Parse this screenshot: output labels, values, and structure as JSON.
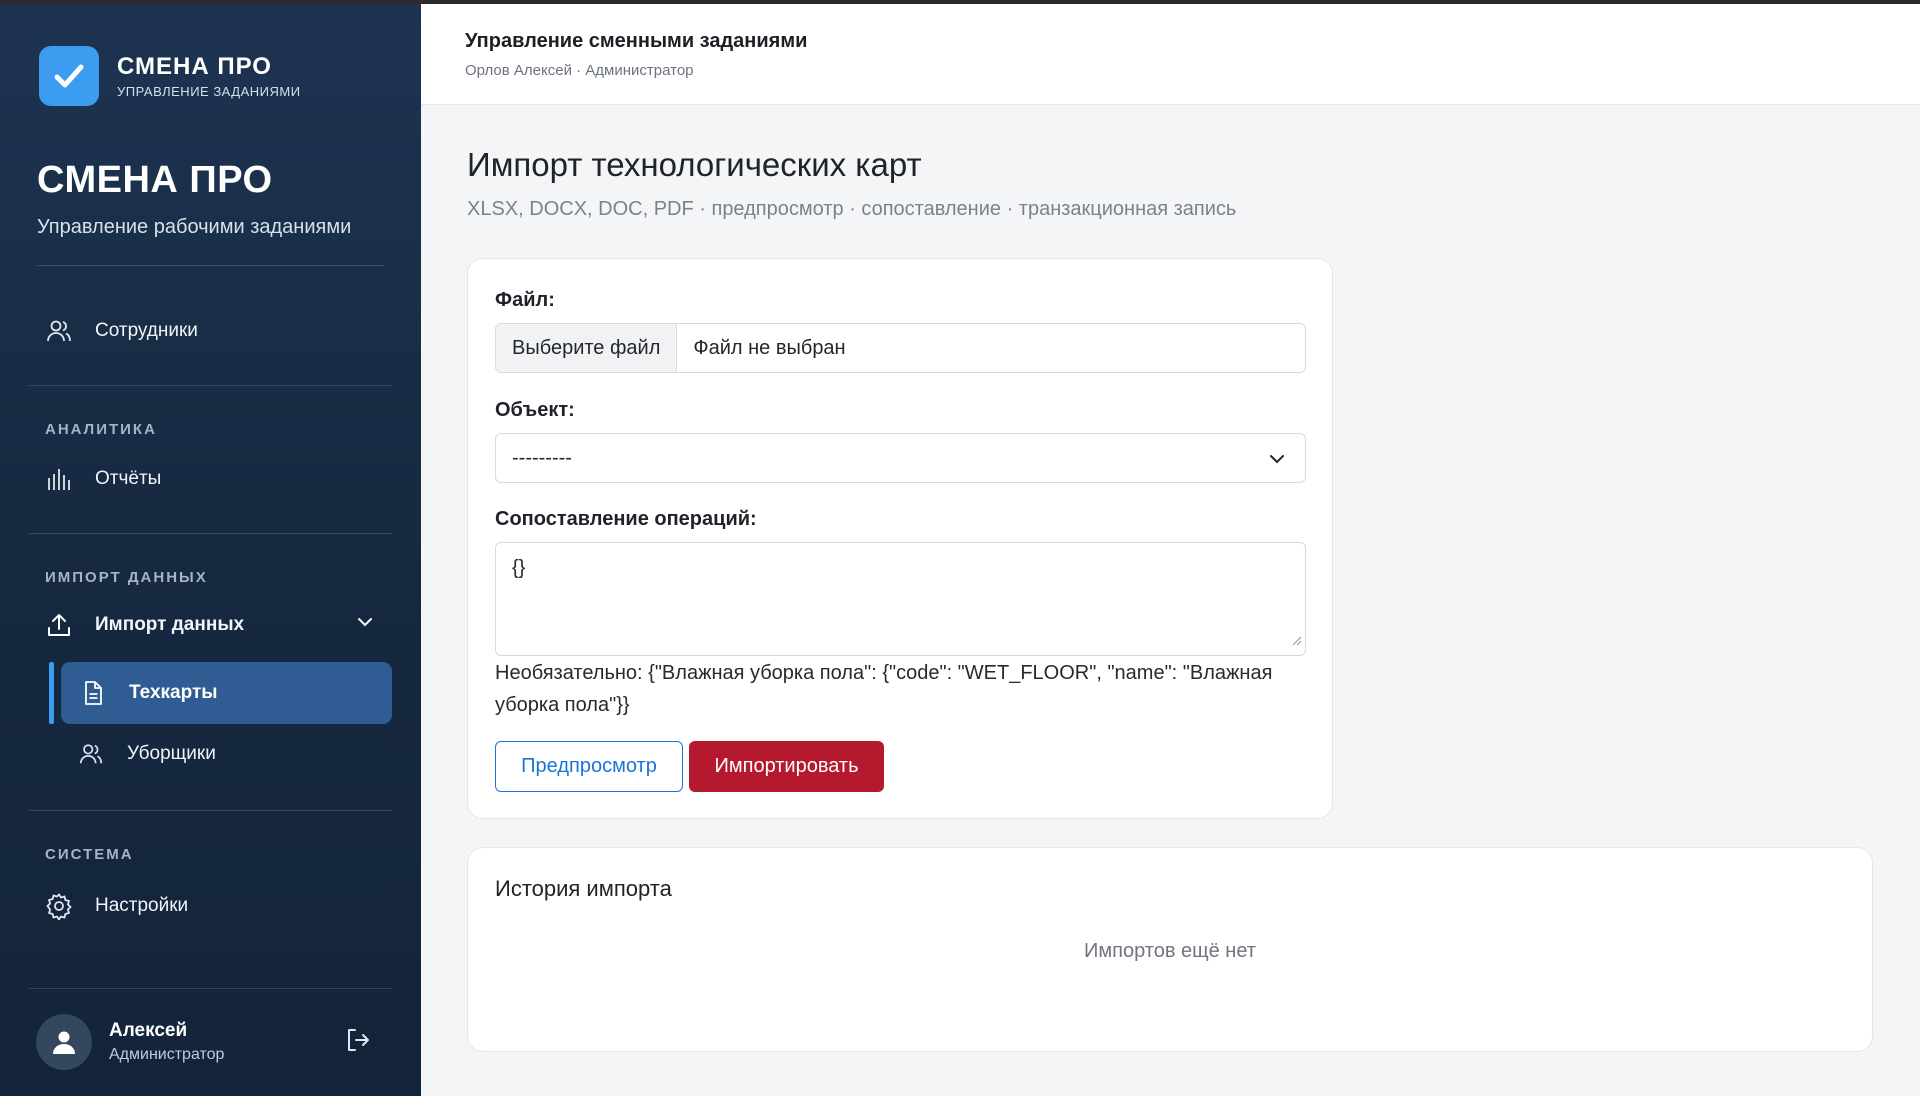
{
  "brand": {
    "name": "СМЕНА ПРО",
    "subtitle": "УПРАВЛЕНИЕ ЗАДАНИЯМИ",
    "logo_icon": "checkmark-icon",
    "accent": "#3b9cf0"
  },
  "hero": {
    "title": "СМЕНА ПРО",
    "subtitle": "Управление рабочими заданиями"
  },
  "sidebar": {
    "items": [
      {
        "label": "Сотрудники",
        "icon": "users-icon"
      },
      {
        "section": "АНАЛИТИКА"
      },
      {
        "label": "Отчёты",
        "icon": "bar-chart-icon"
      },
      {
        "section": "ИМПОРТ ДАННЫХ"
      },
      {
        "label": "Импорт данных",
        "icon": "upload-icon",
        "expanded": true
      },
      {
        "label": "Техкарты",
        "icon": "document-icon",
        "active": true
      },
      {
        "label": "Уборщики",
        "icon": "users-icon"
      },
      {
        "section": "СИСТЕМА"
      },
      {
        "label": "Настройки",
        "icon": "gear-icon"
      }
    ]
  },
  "user": {
    "name": "Алексей",
    "role": "Администратор"
  },
  "header": {
    "title": "Управление сменными заданиями",
    "subtitle": "Орлов Алексей · Администратор"
  },
  "page": {
    "title": "Импорт технологических карт",
    "subtitle": "XLSX, DOCX, DOC, PDF · предпросмотр · сопоставление · транзакционная запись"
  },
  "form": {
    "file_label": "Файл:",
    "file_button": "Выберите файл",
    "file_value": "Файл не выбран",
    "object_label": "Объект:",
    "object_value": "---------",
    "mapping_label": "Сопоставление операций:",
    "mapping_value": "{}",
    "mapping_help": "Необязательно: {\"Влажная уборка пола\": {\"code\": \"WET_FLOOR\", \"name\": \"Влажная уборка пола\"}}",
    "preview_button": "Предпросмотр",
    "import_button": "Импортировать"
  },
  "history": {
    "title": "История импорта",
    "empty": "Импортов ещё нет"
  },
  "colors": {
    "sidebar_bg": "#1d3350",
    "active_item": "#2f5c92",
    "primary": "#1e74d6",
    "danger": "#b5192e"
  }
}
